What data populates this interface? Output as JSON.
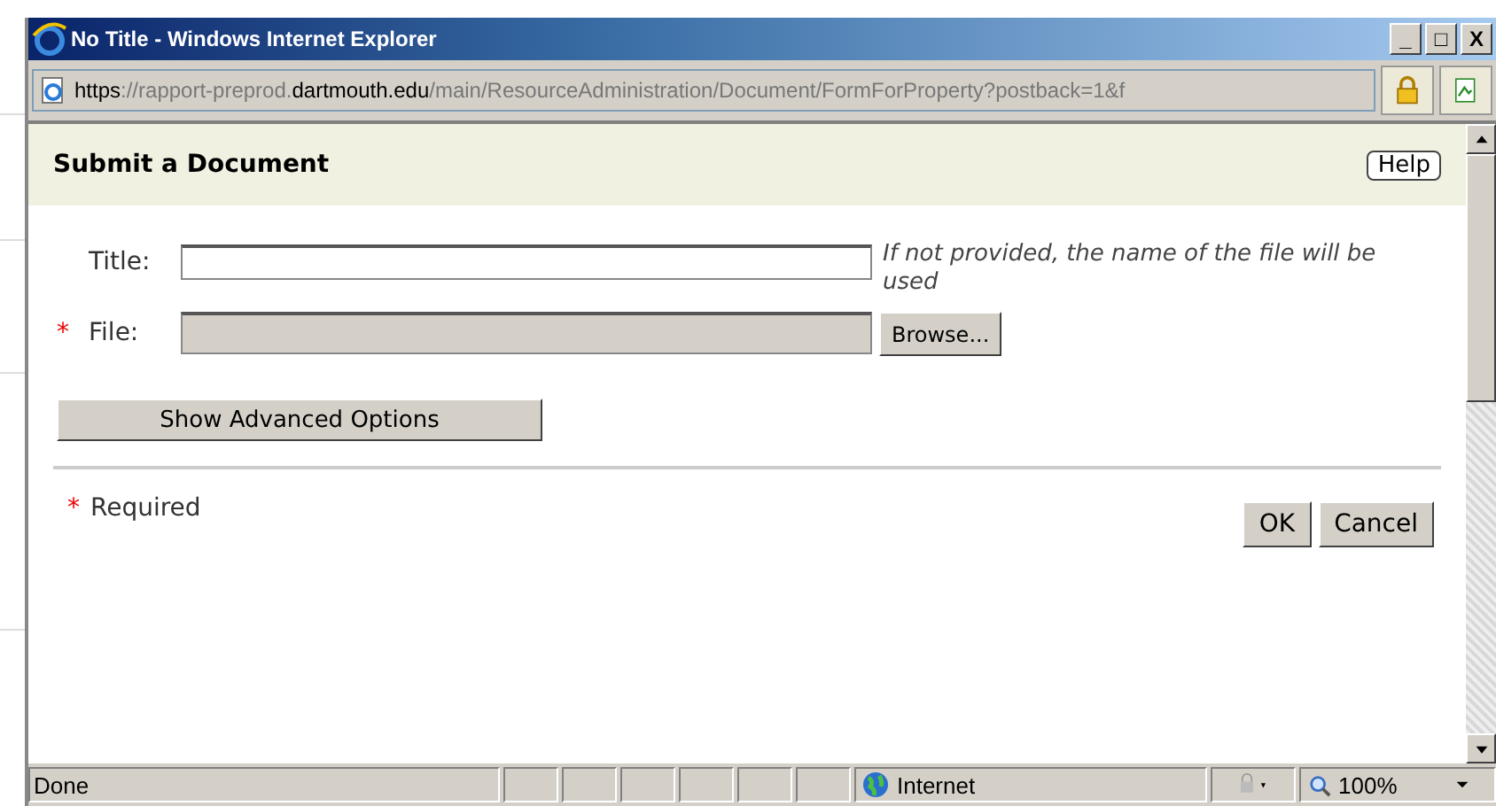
{
  "window": {
    "title": "No Title - Windows Internet Explorer",
    "controls": [
      "_",
      "□",
      "X"
    ]
  },
  "address": {
    "parts": [
      {
        "text": "https",
        "strong": true
      },
      {
        "text": "://rapport-preprod.",
        "strong": false
      },
      {
        "text": "dartmouth.edu",
        "strong": true
      },
      {
        "text": "/main/ResourceAdministration/Document/FormForProperty?postback=1&f",
        "strong": false
      }
    ]
  },
  "dialog": {
    "heading": "Submit a Document",
    "help_button": "Help",
    "fields": [
      {
        "label": "Title:",
        "required": false,
        "kind": "text",
        "hint": "If not provided, the name of the file will be used"
      },
      {
        "label": "File:",
        "required": true,
        "kind": "file",
        "button": "Browse..."
      }
    ],
    "advanced_button": "Show Advanced Options",
    "required_mark": "*",
    "required_note": "Required",
    "buttons": [
      "OK",
      "Cancel"
    ]
  },
  "status_bar": {
    "text": "Done",
    "zone": "Internet",
    "zoom": "100%"
  }
}
